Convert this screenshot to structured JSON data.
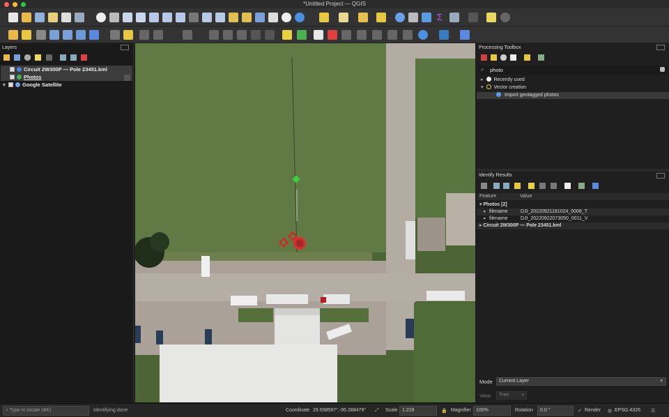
{
  "window": {
    "title": "*Untitled Project — QGIS"
  },
  "layers_panel": {
    "title": "Layers",
    "layers": [
      {
        "name": "Circuit 2W300P — Pole 23451.kml",
        "color": "#4a7fd6"
      },
      {
        "name": "Photos",
        "color": "#3fb34f"
      },
      {
        "name": "Google Satellite",
        "color": "#6aa3e8"
      }
    ]
  },
  "processing_toolbox": {
    "title": "Processing Toolbox",
    "search_value": "photo",
    "items": [
      {
        "label": "Recently used"
      },
      {
        "label": "Vector creation"
      },
      {
        "label": "Import geotagged photos"
      }
    ]
  },
  "identify_results": {
    "title": "Identify Results",
    "headers": {
      "feature": "Feature",
      "value": "Value"
    },
    "photos_group": "Photos  [2]",
    "rows": [
      {
        "field": "filename",
        "value": "DJI_20220921181024_0006_T"
      },
      {
        "field": "filename",
        "value": "DJI_20220922073050_0011_V"
      }
    ],
    "circuit_group": "Circuit 2W300P — Pole 23451.kml",
    "mode_label": "Mode",
    "mode_value": "Current Layer",
    "view_label": "View",
    "view_value": "Tree"
  },
  "status_bar": {
    "locate_placeholder": "Type to locate (⌘K)",
    "message": "Identifying done",
    "coordinate_label": "Coordinate",
    "coordinate_value": "29.558597°,-95.288479°",
    "scale_label": "Scale",
    "scale_value": "1:228",
    "magnifier_label": "Magnifier",
    "magnifier_value": "100%",
    "rotation_label": "Rotation",
    "rotation_value": "0.0 °",
    "render_label": "Render",
    "crs": "EPSG:4326"
  },
  "colors": {
    "accent": "#2f5fa8",
    "feature_red": "#e02020",
    "feature_green": "#3fcf3f"
  }
}
